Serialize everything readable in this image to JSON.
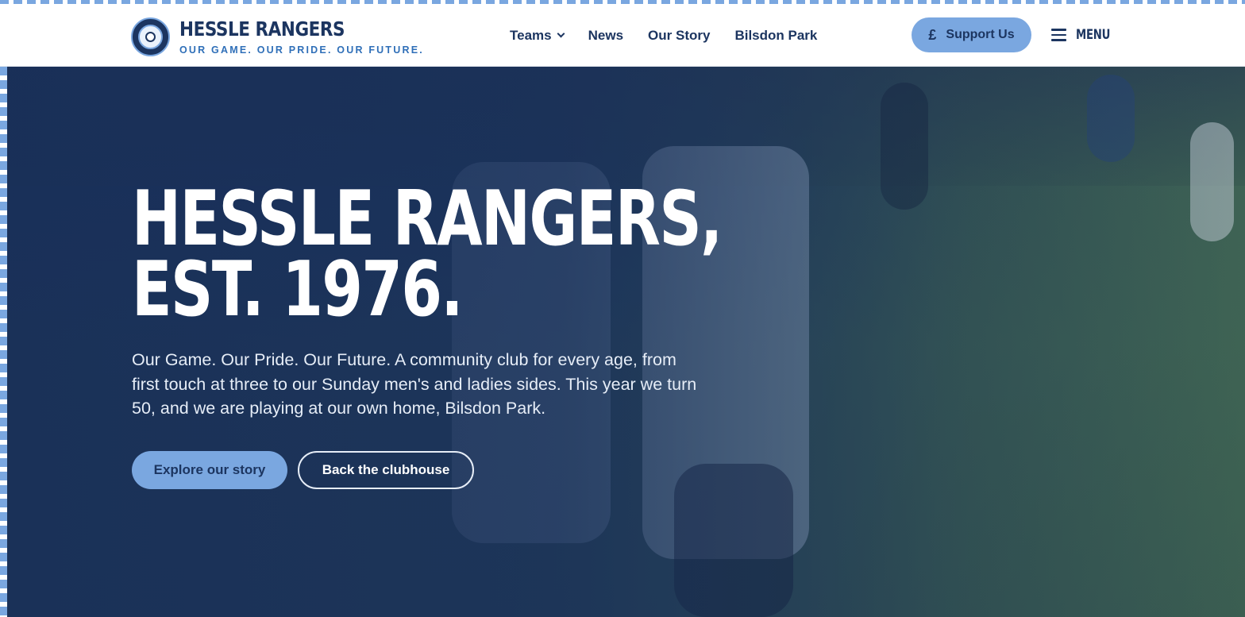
{
  "brand": {
    "name": "HESSLE RANGERS",
    "tagline": "OUR GAME. OUR PRIDE. OUR FUTURE.",
    "crest_icon": "club-crest-icon"
  },
  "nav": {
    "items": [
      {
        "label": "Teams",
        "has_dropdown": true,
        "icon": "chevron-down-icon"
      },
      {
        "label": "News"
      },
      {
        "label": "Our Story"
      },
      {
        "label": "Bilsdon Park"
      }
    ]
  },
  "header_actions": {
    "support_label": "Support Us",
    "support_icon_glyph": "£",
    "menu_label": "MENU",
    "menu_icon": "hamburger-icon"
  },
  "hero": {
    "title_line1": "HESSLE RANGERS,",
    "title_line2": "EST. 1976.",
    "text": "Our Game. Our Pride. Our Future. A community club for every age, from first touch at three to our Sunday men's and ladies sides. This year we turn 50, and we are playing at our own home, Bilsdon Park.",
    "primary_button": "Explore our story",
    "secondary_button": "Back the clubhouse",
    "background": "photo of young players on a football pitch"
  },
  "colors": {
    "navy": "#1c3560",
    "sky_blue": "#7aa7e0",
    "tagline_blue": "#2f6fb8",
    "white": "#ffffff"
  }
}
